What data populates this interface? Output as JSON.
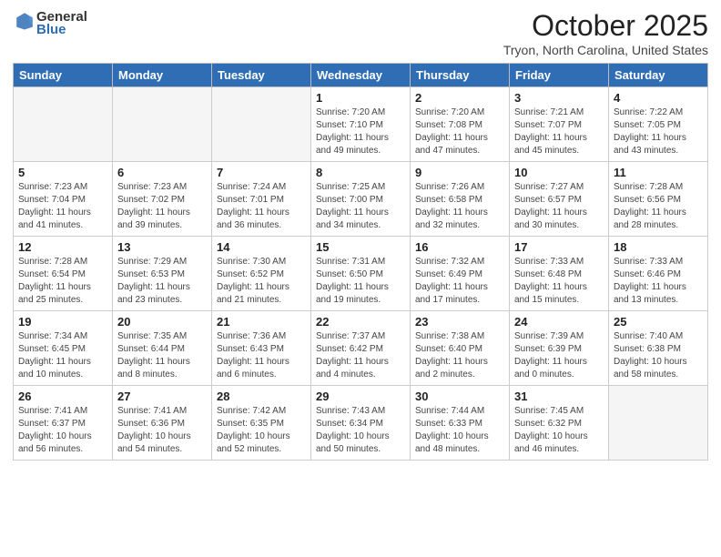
{
  "header": {
    "logo_general": "General",
    "logo_blue": "Blue",
    "month_title": "October 2025",
    "location": "Tryon, North Carolina, United States"
  },
  "weekdays": [
    "Sunday",
    "Monday",
    "Tuesday",
    "Wednesday",
    "Thursday",
    "Friday",
    "Saturday"
  ],
  "weeks": [
    [
      {
        "day": "",
        "info": ""
      },
      {
        "day": "",
        "info": ""
      },
      {
        "day": "",
        "info": ""
      },
      {
        "day": "1",
        "info": "Sunrise: 7:20 AM\nSunset: 7:10 PM\nDaylight: 11 hours\nand 49 minutes."
      },
      {
        "day": "2",
        "info": "Sunrise: 7:20 AM\nSunset: 7:08 PM\nDaylight: 11 hours\nand 47 minutes."
      },
      {
        "day": "3",
        "info": "Sunrise: 7:21 AM\nSunset: 7:07 PM\nDaylight: 11 hours\nand 45 minutes."
      },
      {
        "day": "4",
        "info": "Sunrise: 7:22 AM\nSunset: 7:05 PM\nDaylight: 11 hours\nand 43 minutes."
      }
    ],
    [
      {
        "day": "5",
        "info": "Sunrise: 7:23 AM\nSunset: 7:04 PM\nDaylight: 11 hours\nand 41 minutes."
      },
      {
        "day": "6",
        "info": "Sunrise: 7:23 AM\nSunset: 7:02 PM\nDaylight: 11 hours\nand 39 minutes."
      },
      {
        "day": "7",
        "info": "Sunrise: 7:24 AM\nSunset: 7:01 PM\nDaylight: 11 hours\nand 36 minutes."
      },
      {
        "day": "8",
        "info": "Sunrise: 7:25 AM\nSunset: 7:00 PM\nDaylight: 11 hours\nand 34 minutes."
      },
      {
        "day": "9",
        "info": "Sunrise: 7:26 AM\nSunset: 6:58 PM\nDaylight: 11 hours\nand 32 minutes."
      },
      {
        "day": "10",
        "info": "Sunrise: 7:27 AM\nSunset: 6:57 PM\nDaylight: 11 hours\nand 30 minutes."
      },
      {
        "day": "11",
        "info": "Sunrise: 7:28 AM\nSunset: 6:56 PM\nDaylight: 11 hours\nand 28 minutes."
      }
    ],
    [
      {
        "day": "12",
        "info": "Sunrise: 7:28 AM\nSunset: 6:54 PM\nDaylight: 11 hours\nand 25 minutes."
      },
      {
        "day": "13",
        "info": "Sunrise: 7:29 AM\nSunset: 6:53 PM\nDaylight: 11 hours\nand 23 minutes."
      },
      {
        "day": "14",
        "info": "Sunrise: 7:30 AM\nSunset: 6:52 PM\nDaylight: 11 hours\nand 21 minutes."
      },
      {
        "day": "15",
        "info": "Sunrise: 7:31 AM\nSunset: 6:50 PM\nDaylight: 11 hours\nand 19 minutes."
      },
      {
        "day": "16",
        "info": "Sunrise: 7:32 AM\nSunset: 6:49 PM\nDaylight: 11 hours\nand 17 minutes."
      },
      {
        "day": "17",
        "info": "Sunrise: 7:33 AM\nSunset: 6:48 PM\nDaylight: 11 hours\nand 15 minutes."
      },
      {
        "day": "18",
        "info": "Sunrise: 7:33 AM\nSunset: 6:46 PM\nDaylight: 11 hours\nand 13 minutes."
      }
    ],
    [
      {
        "day": "19",
        "info": "Sunrise: 7:34 AM\nSunset: 6:45 PM\nDaylight: 11 hours\nand 10 minutes."
      },
      {
        "day": "20",
        "info": "Sunrise: 7:35 AM\nSunset: 6:44 PM\nDaylight: 11 hours\nand 8 minutes."
      },
      {
        "day": "21",
        "info": "Sunrise: 7:36 AM\nSunset: 6:43 PM\nDaylight: 11 hours\nand 6 minutes."
      },
      {
        "day": "22",
        "info": "Sunrise: 7:37 AM\nSunset: 6:42 PM\nDaylight: 11 hours\nand 4 minutes."
      },
      {
        "day": "23",
        "info": "Sunrise: 7:38 AM\nSunset: 6:40 PM\nDaylight: 11 hours\nand 2 minutes."
      },
      {
        "day": "24",
        "info": "Sunrise: 7:39 AM\nSunset: 6:39 PM\nDaylight: 11 hours\nand 0 minutes."
      },
      {
        "day": "25",
        "info": "Sunrise: 7:40 AM\nSunset: 6:38 PM\nDaylight: 10 hours\nand 58 minutes."
      }
    ],
    [
      {
        "day": "26",
        "info": "Sunrise: 7:41 AM\nSunset: 6:37 PM\nDaylight: 10 hours\nand 56 minutes."
      },
      {
        "day": "27",
        "info": "Sunrise: 7:41 AM\nSunset: 6:36 PM\nDaylight: 10 hours\nand 54 minutes."
      },
      {
        "day": "28",
        "info": "Sunrise: 7:42 AM\nSunset: 6:35 PM\nDaylight: 10 hours\nand 52 minutes."
      },
      {
        "day": "29",
        "info": "Sunrise: 7:43 AM\nSunset: 6:34 PM\nDaylight: 10 hours\nand 50 minutes."
      },
      {
        "day": "30",
        "info": "Sunrise: 7:44 AM\nSunset: 6:33 PM\nDaylight: 10 hours\nand 48 minutes."
      },
      {
        "day": "31",
        "info": "Sunrise: 7:45 AM\nSunset: 6:32 PM\nDaylight: 10 hours\nand 46 minutes."
      },
      {
        "day": "",
        "info": ""
      }
    ]
  ]
}
